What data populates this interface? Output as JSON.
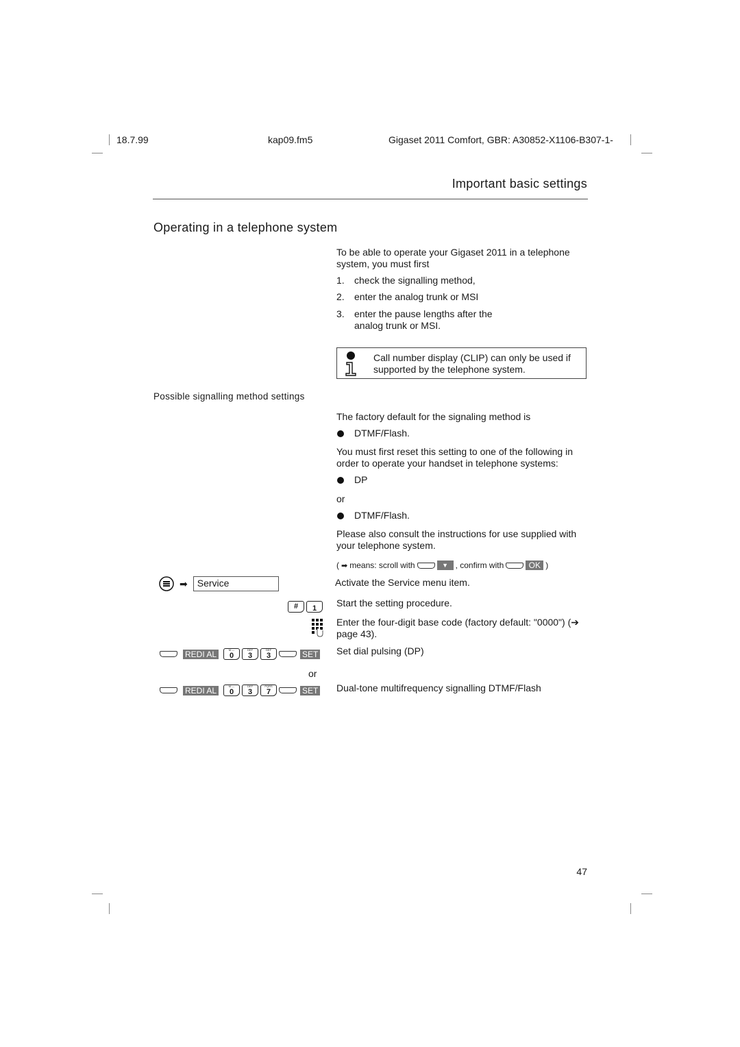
{
  "header": {
    "date": "18.7.99",
    "file": "kap09.fm5",
    "product": "Gigaset 2011 Comfort, GBR: A30852-X1106-B307-1-"
  },
  "chapter_title": "Important basic settings",
  "section_title": "Operating in a telephone system",
  "intro": {
    "text": "To be able to operate your Gigaset 2011 in a telephone system, you must first",
    "steps": [
      {
        "num": "1.",
        "text": "check the signalling method,"
      },
      {
        "num": "2.",
        "text": "enter the analog trunk or MSI"
      },
      {
        "num": "3.",
        "text": "enter the pause lengths after the analog trunk or MSI."
      }
    ]
  },
  "info_note": "Call number display (CLIP) can only be used if supported by the telephone system.",
  "subsection_title": "Possible signalling method settings",
  "signalling": {
    "factory_default_text": "The factory default for the signaling method is",
    "default_value": "DTMF/Flash.",
    "reset_text": "You must first reset this setting to one of the following in order to operate your handset in telephone systems:",
    "option_1": "DP",
    "or": "or",
    "option_2": "DTMF/Flash.",
    "consult_text": "Please also consult the instructions for use supplied with your telephone system."
  },
  "legend": {
    "open": "(",
    "means": "means: scroll with",
    "confirm": ", confirm with",
    "ok_label": "OK",
    "close": ")"
  },
  "steps": [
    {
      "menu_item": "Service",
      "description": "Activate the Service menu item."
    },
    {
      "keys": [
        "#",
        "1"
      ],
      "description": "Start the setting procedure."
    },
    {
      "description": "Enter the four-digit base code (factory default: \"0000\") (➔ page 43)."
    },
    {
      "redial_label": "REDI AL",
      "digits": [
        "0",
        "3",
        "3"
      ],
      "set_label": "SET",
      "description": "Set dial pulsing (DP)"
    },
    {
      "or": "or"
    },
    {
      "redial_label": "REDI AL",
      "digits": [
        "0",
        "3",
        "7"
      ],
      "set_label": "SET",
      "description": "Dual-tone multifrequency signalling DTMF/Flash"
    }
  ],
  "key_subs": {
    "k0": "M —",
    "k3": "DEF",
    "k7": "PQRS"
  },
  "page_number": "47"
}
